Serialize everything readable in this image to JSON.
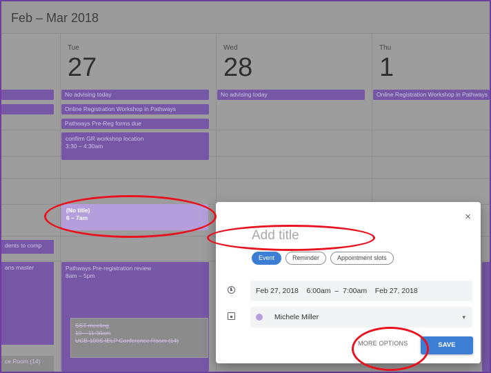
{
  "header": {
    "range_title": "Feb – Mar 2018"
  },
  "days": [
    {
      "name": "Tue",
      "number": "27"
    },
    {
      "name": "Wed",
      "number": "28"
    },
    {
      "name": "Thu",
      "number": "1"
    }
  ],
  "allday": {
    "tue": [
      "No advising today",
      "Online Registration Workshop in Pathways",
      "Pathways Pre-Reg forms due"
    ],
    "wed": [
      "No advising today"
    ],
    "thu": [
      "Online Registration Workshop in Pathways"
    ]
  },
  "events": {
    "confirm": {
      "title": "confirm GR workshop location",
      "time": "3:30 – 4:30am"
    },
    "new_event": {
      "title": "(No title)",
      "time": "6 – 7am"
    },
    "pathways_review": {
      "title": "Pathways Pre-registration review",
      "time": "8am – 5pm"
    },
    "sst": {
      "title": "SST meeting",
      "time": "10 – 11:30am",
      "location": "UCB-100S IELP Conference Room (14)"
    },
    "left_cut_1": "dents to comp",
    "left_cut_2": "ans master",
    "left_cut_3": "ce Room (14)"
  },
  "dialog": {
    "close": "×",
    "title_placeholder": "Add title",
    "tabs": [
      "Event",
      "Reminder",
      "Appointment slots"
    ],
    "datetime": "Feb 27, 2018    6:00am  –  7:00am    Feb 27, 2018",
    "calendar_owner": "Michele Miller",
    "calendar_color": "#b49fdc",
    "more_options": "MORE OPTIONS",
    "save": "SAVE"
  },
  "colors": {
    "accent": "#3b7ed3",
    "event": "#7657a6",
    "highlight": "#e8121e"
  }
}
